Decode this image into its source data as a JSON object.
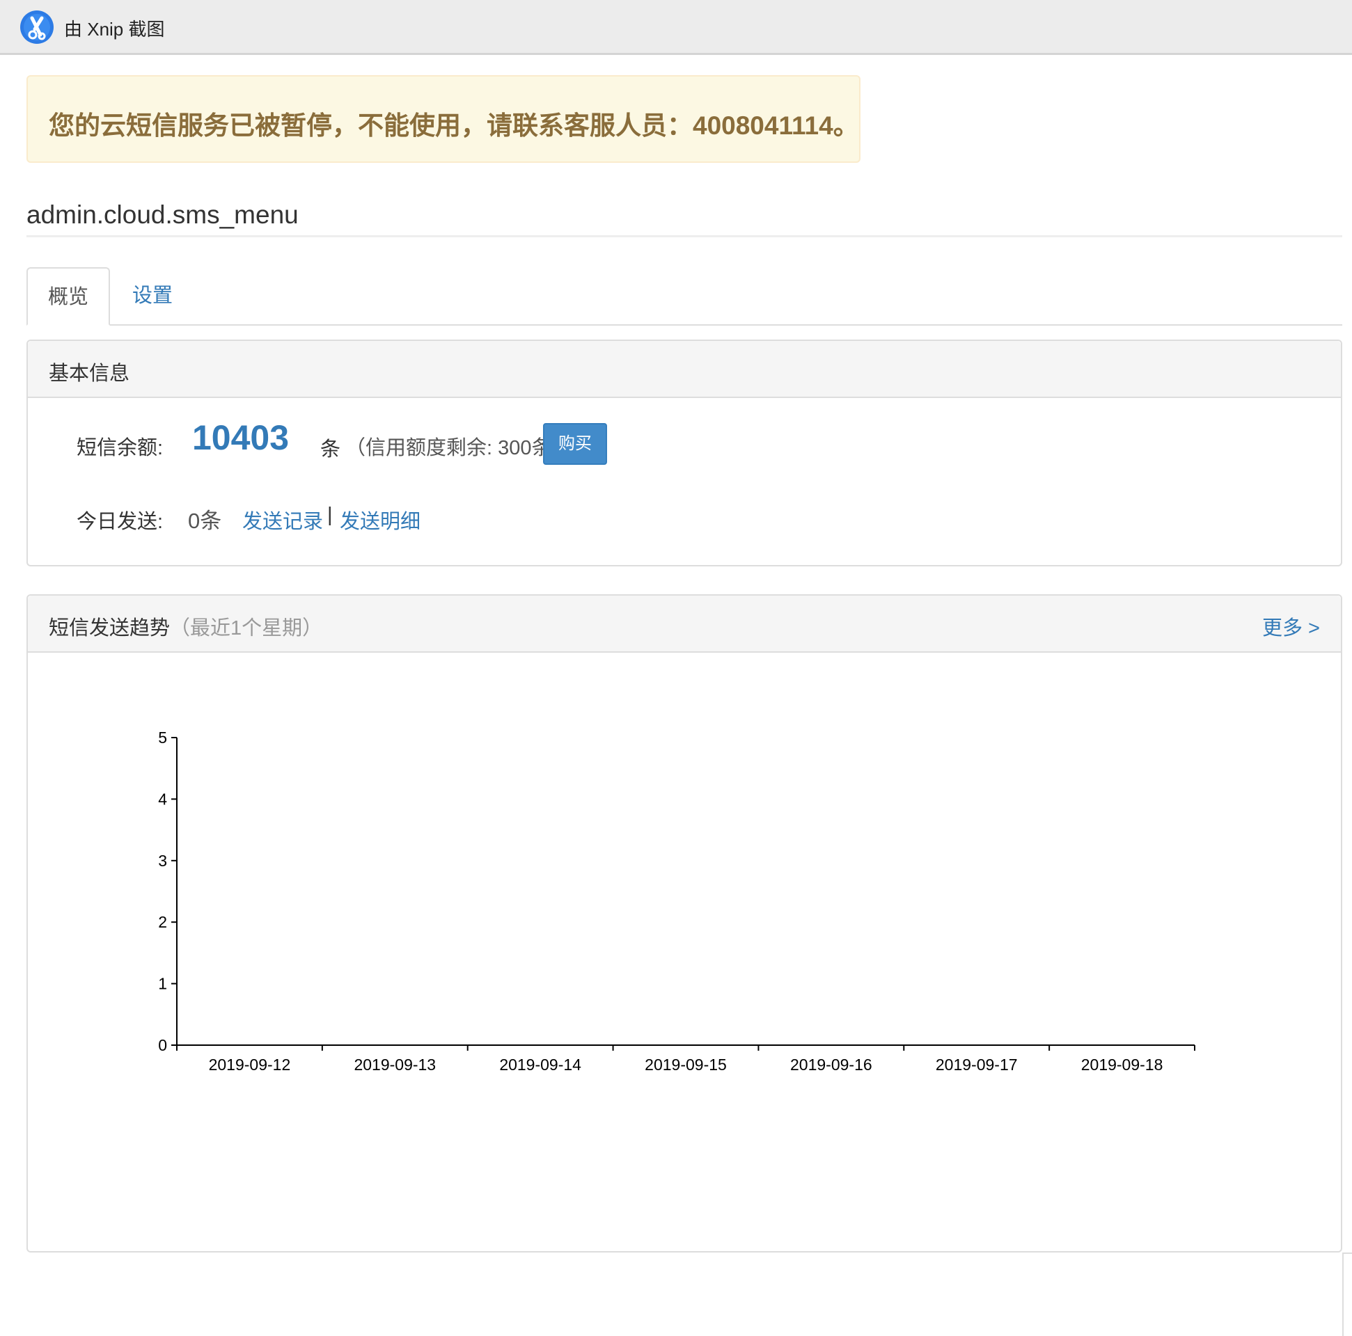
{
  "xnip_bar": {
    "label": "由 Xnip 截图"
  },
  "alert": {
    "message": "您的云短信服务已被暂停，不能使用，请联系客服人员：4008041114。"
  },
  "page_title": "admin.cloud.sms_menu",
  "tabs": [
    {
      "label": "概览",
      "active": true
    },
    {
      "label": "设置",
      "active": false
    }
  ],
  "basic_info": {
    "heading": "基本信息",
    "balance_label": "短信余额:",
    "balance_value": "10403",
    "balance_unit": "条",
    "credit_text": "（信用额度剩余: 300条）",
    "buy_label": "购买",
    "today_label": "今日发送:",
    "today_value": "0条",
    "send_record_link": "发送记录",
    "separator": "|",
    "send_detail_link": "发送明细"
  },
  "trend": {
    "heading": "短信发送趋势",
    "subheading": "（最近1个星期）",
    "more_label": "更多 >"
  },
  "colors": {
    "alert_bg": "#fcf8e3",
    "alert_text": "#8a6d3b",
    "link": "#337ab7",
    "button": "#428bca"
  },
  "chart_data": {
    "type": "bar",
    "categories": [
      "2019-09-12",
      "2019-09-13",
      "2019-09-14",
      "2019-09-15",
      "2019-09-16",
      "2019-09-17",
      "2019-09-18"
    ],
    "values": [
      0,
      0,
      0,
      0,
      0,
      0,
      0
    ],
    "yticks": [
      0,
      1,
      2,
      3,
      4,
      5
    ],
    "ylim": [
      0,
      5
    ],
    "xlabel": "",
    "ylabel": "",
    "grid": false
  }
}
